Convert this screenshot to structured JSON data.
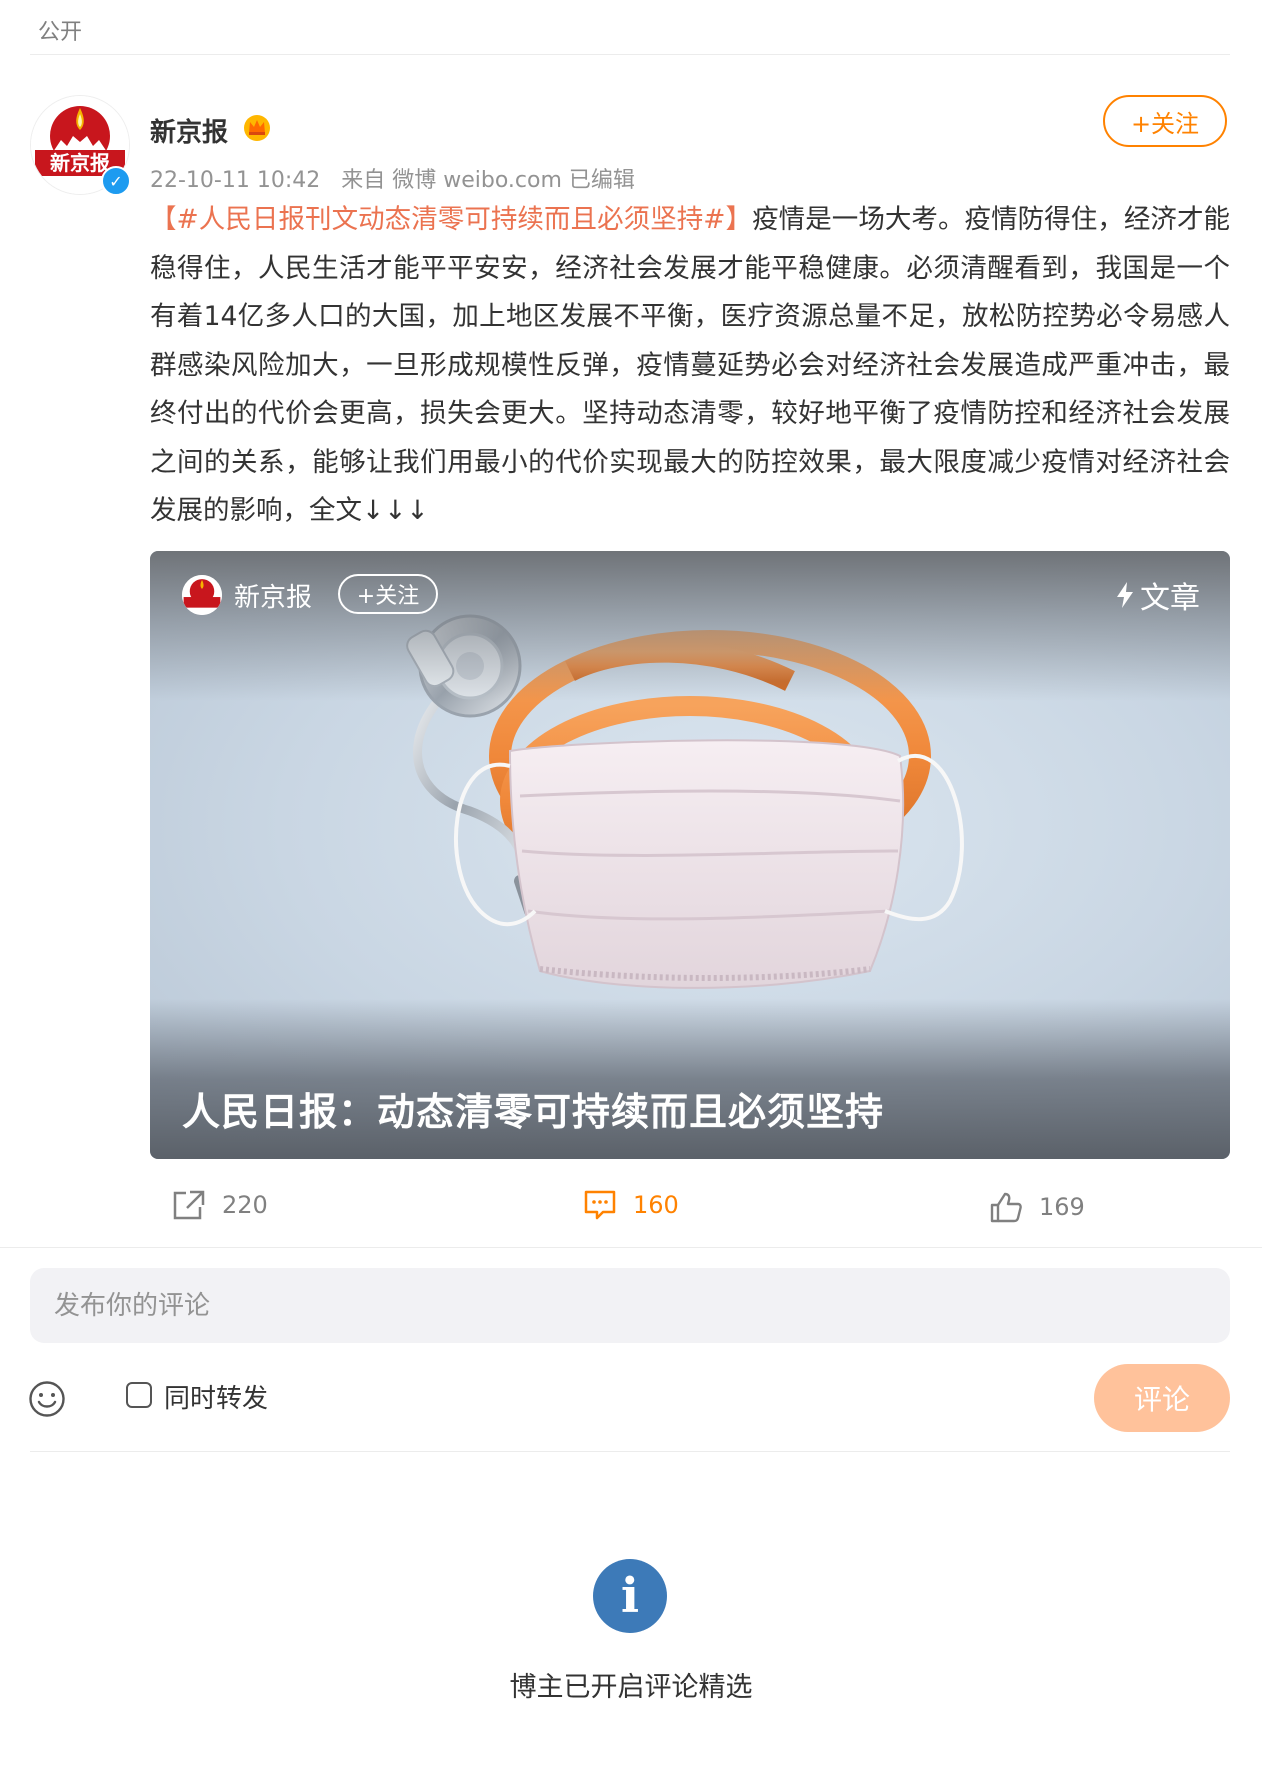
{
  "visibility": "公开",
  "post": {
    "author": "新京报",
    "timestamp": "22-10-11 10:42",
    "source": "来自 微博 weibo.com",
    "edited": "已编辑",
    "follow_label": "+关注",
    "hashtag": "【#人民日报刊文动态清零可持续而且必须坚持#】",
    "body": "疫情是一场大考。疫情防得住，经济才能稳得住，人民生活才能平平安安，经济社会发展才能平稳健康。必须清醒看到，我国是一个有着14亿多人口的大国，加上地区发展不平衡，医疗资源总量不足，放松防控势必令易感人群感染风险加大，一旦形成规模性反弹，疫情蔓延势必会对经济社会发展造成严重冲击，最终付出的代价会更高，损失会更大。坚持动态清零，较好地平衡了疫情防控和经济社会发展之间的关系，能够让我们用最小的代价实现最大的防控效果，最大限度减少疫情对经济社会发展的影响，全文↓↓↓"
  },
  "article_card": {
    "source": "新京报",
    "follow_label": "+关注",
    "type_label": "文章",
    "title": "人民日报：动态清零可持续而且必须坚持"
  },
  "actions": {
    "repost_count": "220",
    "comment_count": "160",
    "like_count": "169"
  },
  "comment": {
    "placeholder": "发布你的评论",
    "repost_label": "同时转发",
    "submit_label": "评论"
  },
  "notice": "博主已开启评论精选",
  "colors": {
    "accent": "#ff8200",
    "hashtag": "#eb7350",
    "info": "#3d7ab8",
    "submit_disabled": "#ffc29b"
  }
}
